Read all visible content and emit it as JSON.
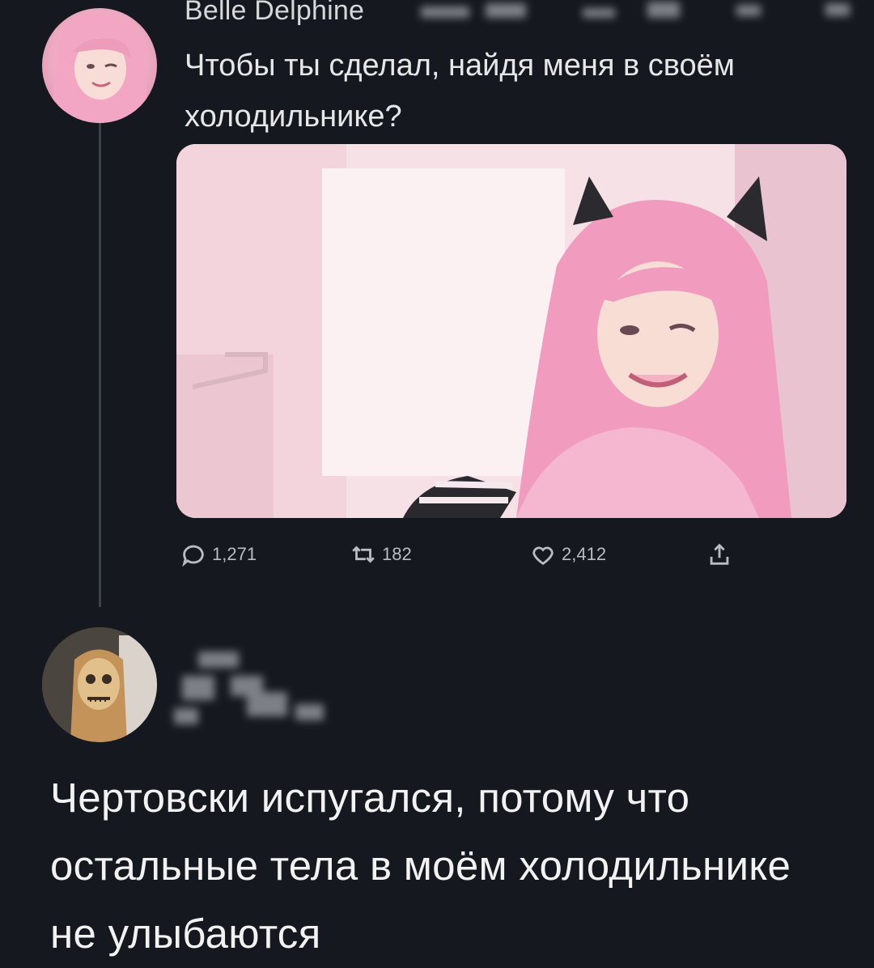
{
  "tweet": {
    "author_name": "Belle Delphine",
    "text": "Чтобы ты сделал, найдя меня в своём холодильнике?",
    "stats": {
      "replies": "1,271",
      "retweets": "182",
      "likes": "2,412"
    }
  },
  "reply": {
    "text": "Чертовски испугался, потому что остальные тела в моём холодильнике не улыбаются"
  },
  "icons": {
    "reply": "comment-icon",
    "retweet": "retweet-icon",
    "like": "heart-icon",
    "share": "share-icon"
  },
  "colors": {
    "background": "#15191f",
    "text": "#e6e7e8",
    "muted": "#b9bcc0",
    "media_pink": "#f0c9d6"
  }
}
